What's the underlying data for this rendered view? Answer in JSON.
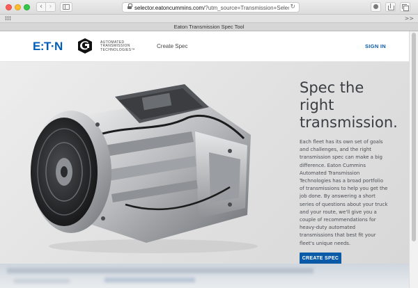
{
  "browser": {
    "url_host": "selector.eatoncummins.com",
    "url_rest": "/?utm_source=Transmission+Selector+Pres",
    "tab_title": "Eaton Transmission Spec Tool",
    "more_label": ">>"
  },
  "header": {
    "brand_eaton": "E:T·N",
    "brand_tagline": [
      "AUTOMATED",
      "TRANSMISSION",
      "TECHNOLOGIES"
    ],
    "tagline_mark": "™",
    "nav_create": "Create Spec",
    "nav_signin": "SIGN IN",
    "brand_color": "#005eb8",
    "cummins_color": "#111111"
  },
  "hero": {
    "title_lines": [
      "Spec the",
      "right",
      "transmission."
    ],
    "body_lines": [
      "Each fleet has its own set of goals",
      "and challenges, and the right",
      "transmission spec can make a big",
      "difference. Eaton Cummins",
      "Automated Transmission",
      "Technologies has a broad portfolio",
      "of transmissions to help you get the",
      "job done. By answering a short",
      "series of questions about your truck",
      "and your route, we'll give you a",
      "couple of recommendations for",
      "heavy-duty automated",
      "transmissions that best fit your",
      "fleet's unique needs."
    ],
    "cta_label": "CREATE SPEC",
    "cta_color": "#0a5aa8",
    "image_icon": "transmission-image"
  }
}
